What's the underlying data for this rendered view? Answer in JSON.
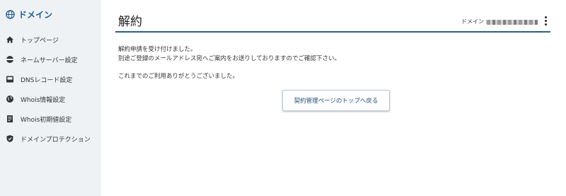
{
  "sidebar": {
    "title": "ドメイン",
    "items": [
      {
        "label": "トップページ",
        "icon": "home-icon"
      },
      {
        "label": "ネームサーバー設定",
        "icon": "nameserver-icon"
      },
      {
        "label": "DNSレコード設定",
        "icon": "dns-record-icon"
      },
      {
        "label": "Whois情報設定",
        "icon": "whois-globe-icon"
      },
      {
        "label": "Whois初期値設定",
        "icon": "whois-document-icon"
      },
      {
        "label": "ドメインプロテクション",
        "icon": "shield-icon"
      }
    ]
  },
  "header": {
    "title": "解約",
    "domain_label": "ドメイン :"
  },
  "messages": {
    "line1": "解約申請を受け付けました。",
    "line2": "別途ご登録のメールアドレス宛へご案内をお送りしておりますのでご確認下さい。",
    "line3": "これまでのご利用ありがとうございました。"
  },
  "back_button": {
    "label": "契約管理ページのトップへ戻る"
  },
  "colors": {
    "brand": "#1f5b96",
    "accent_line": "#2f5f86",
    "sidebar_bg": "#eef2f5"
  }
}
